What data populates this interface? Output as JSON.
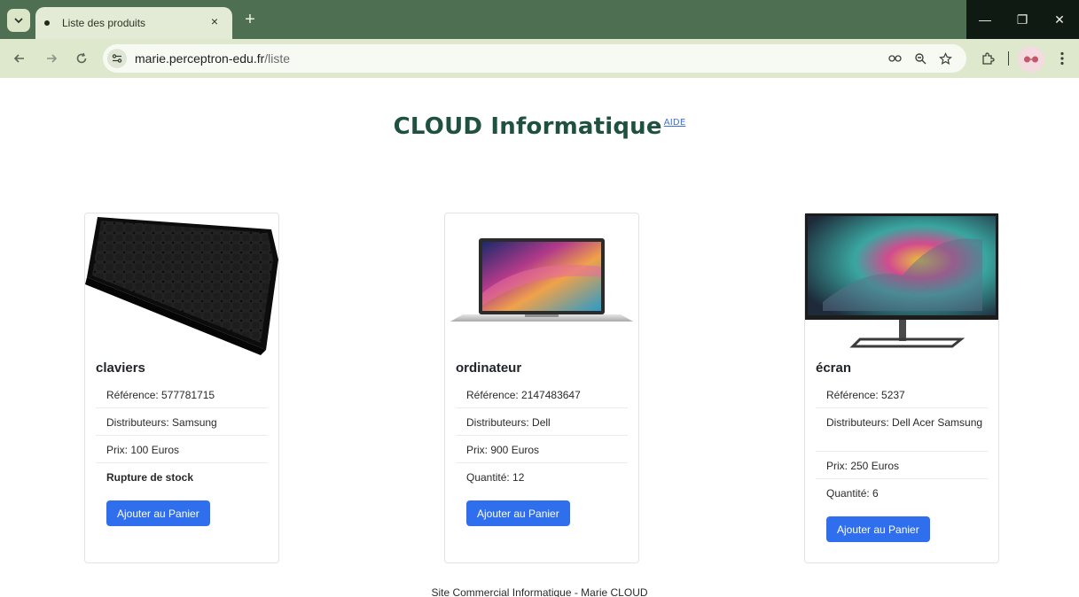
{
  "browser": {
    "tab_title": "Liste des produits",
    "tab_close": "×",
    "new_tab": "+",
    "url_host": "marie.perceptron-edu.fr",
    "url_path": "/liste",
    "window_min": "—",
    "window_restore": "❐",
    "window_close": "✕"
  },
  "icons": {
    "tab_menu": "chevron-down-icon",
    "back": "arrow-left-icon",
    "forward": "arrow-right-icon",
    "reload": "reload-icon",
    "site_info": "tune-icon",
    "password": "key-icon",
    "zoom": "zoom-icon",
    "bookmark": "star-icon",
    "extensions": "puzzle-icon",
    "profile": "avatar-icon",
    "menu": "kebab-icon"
  },
  "header": {
    "title": "CLOUD Informatique",
    "help_link": "AIDE"
  },
  "products": [
    {
      "name": "claviers",
      "reference": "Référence: 577781715",
      "distributors": "Distributeurs: Samsung",
      "price": "Prix: 100 Euros",
      "stock": "Rupture de stock",
      "button": "Ajouter au Panier"
    },
    {
      "name": "ordinateur",
      "reference": "Référence: 2147483647",
      "distributors": "Distributeurs: Dell",
      "price": "Prix: 900 Euros",
      "stock": "Quantité: 12",
      "button": "Ajouter au Panier"
    },
    {
      "name": "écran",
      "reference": "Référence: 5237",
      "distributors": "Distributeurs: Dell  Acer Samsung",
      "price": "Prix: 250 Euros",
      "stock": "Quantité: 6",
      "button": "Ajouter au Panier"
    }
  ],
  "footer": {
    "text": "Site Commercial Informatique - Marie CLOUD"
  },
  "colors": {
    "title": "#1f5140",
    "button": "#2f6fed",
    "link": "#3b6fd4",
    "tabbar": "#4f6f52",
    "toolbar": "#dde8cc"
  }
}
